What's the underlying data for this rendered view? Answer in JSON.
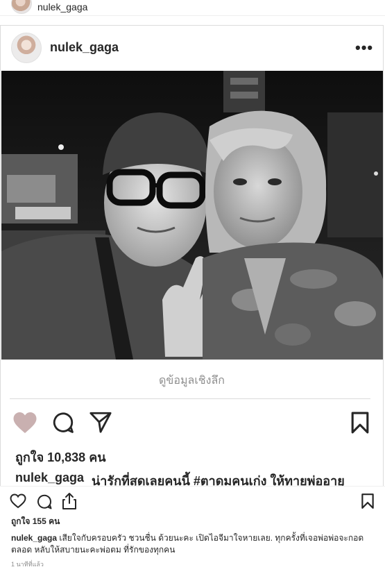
{
  "top_bar": {
    "username": "nulek_gaga"
  },
  "post": {
    "username": "nulek_gaga",
    "more_label": "•••",
    "insights_label": "ดูข้อมูลเชิงลึก",
    "likes_text": "ถูกใจ 10,838 คน",
    "caption_user": "nulek_gaga",
    "caption_text": "น่ารักที่สุดเลยคนนี้ #ตาดมคนเก่ง ให้ทายพ่ออายุ",
    "heart_color": "#c9b0b0"
  },
  "bottom": {
    "likes_text": "ถูกใจ 155 คน",
    "caption_user": "nulek_gaga",
    "caption_text": "เสียใจกับครอบครัว ชวนชื่น ด้วยนะคะ เปิดไอจีมาใจหายเลย. ทุกครั้งที่เจอพ่อพ่อจะกอด ตลอด หลับให้สบายนะคะพ่อตม ที่รักของทุกคน",
    "time_text": "1 นาทีที่แล้ว"
  }
}
